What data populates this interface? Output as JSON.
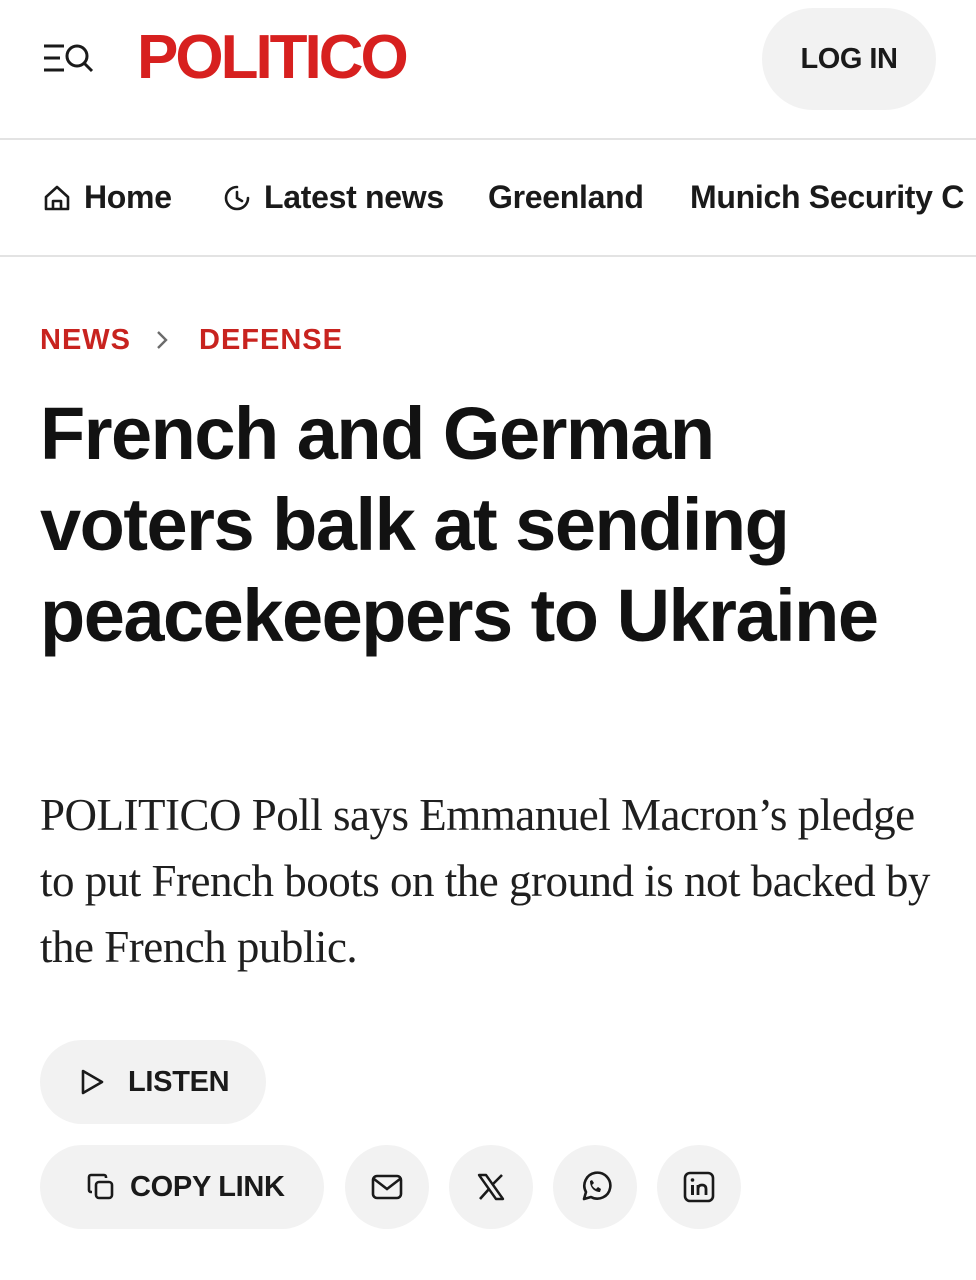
{
  "header": {
    "logo_text": "POLITICO",
    "login_label": "LOG IN",
    "menu_icon": "menu-search-icon",
    "brand_color": "#d7201f"
  },
  "nav": {
    "items": [
      {
        "label": "Home",
        "icon": "home-icon"
      },
      {
        "label": "Latest news",
        "icon": "clock-icon"
      },
      {
        "label": "Greenland"
      },
      {
        "label": "Munich Security C"
      }
    ]
  },
  "breadcrumb": {
    "items": [
      "NEWS",
      "DEFENSE"
    ],
    "separator_icon": "chevron-right-icon",
    "color": "#c8231f"
  },
  "article": {
    "headline": "French and German voters balk at sending peacekeepers to Ukraine",
    "dek": "POLITICO Poll says Emmanuel Macron’s pledge to put French boots on the ground is not backed by the French public."
  },
  "actions": {
    "listen_label": "LISTEN",
    "copy_link_label": "COPY LINK",
    "share_icons": [
      "mail-icon",
      "x-icon",
      "whatsapp-icon",
      "linkedin-icon"
    ]
  }
}
